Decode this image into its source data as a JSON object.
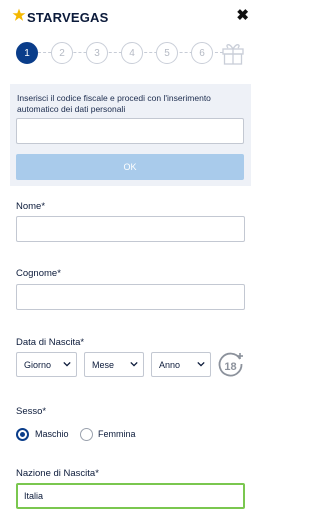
{
  "header": {
    "brand": "STARVEGAS",
    "brand_color": "#f5b800",
    "close_icon": "close-icon"
  },
  "stepper": {
    "steps": [
      "1",
      "2",
      "3",
      "4",
      "5",
      "6"
    ],
    "active_step": "1",
    "final_icon": "gift-icon"
  },
  "fiscal": {
    "instructions": "Inserisci il codice fiscale e procedi con l'inserimento automatico dei dati personali",
    "input_value": "",
    "ok_label": "OK"
  },
  "form": {
    "nome_label": "Nome*",
    "nome_value": "",
    "cognome_label": "Cognome*",
    "cognome_value": "",
    "nascita_label": "Data di Nascita*",
    "giorno": "Giorno",
    "mese": "Mese",
    "anno": "Anno",
    "age_badge": "18",
    "sesso_label": "Sesso*",
    "maschio": "Maschio",
    "femmina": "Femmina",
    "selected_sex": "Maschio",
    "nazione_label": "Nazione di Nascita*",
    "nazione_value": "Italia"
  },
  "colors": {
    "primary": "#0a3d8a",
    "button_disabled": "#a9cbeb",
    "valid_border": "#7ac74f"
  }
}
